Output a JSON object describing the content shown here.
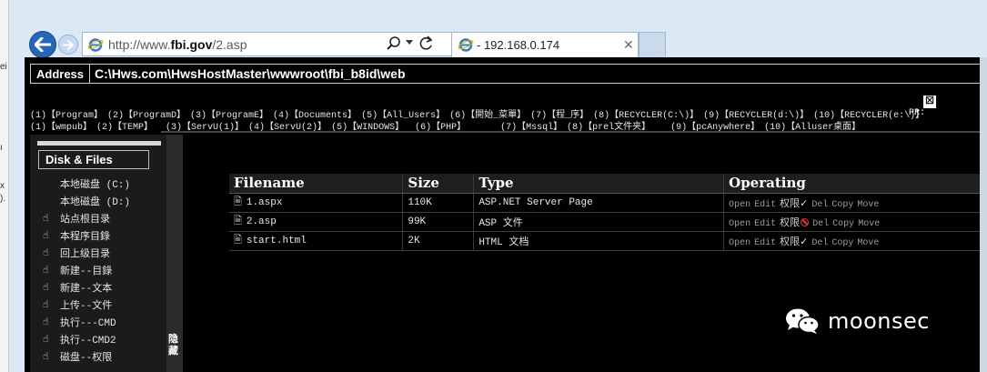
{
  "browser": {
    "url_prefix": "http://www.",
    "url_domain": "fbi.gov",
    "url_suffix": "/2.asp",
    "tab_title": "- 192.168.0.174"
  },
  "address": {
    "label": "Address",
    "path": "C:\\Hws.com\\HwsHostMaster\\wwwroot\\fbi_b8id\\web"
  },
  "dir_links_row1": [
    "(1)【Program】",
    "(2)【ProgramD】",
    "(3)【ProgramE】",
    "(4)【Documents】",
    "(5)【All_Users】",
    "(6)【開始_菜單】",
    "(7)【程_序】",
    "(8)【RECYCLER(C:\\)】",
    "(9)【RECYCLER(d:\\)】",
    "(10)【RECYCLER(e:\\)】"
  ],
  "dir_links_row2": [
    "(1)【wmpub】",
    "(2)【TEMP】",
    "(3)【ServU(1)】",
    "(4)【ServU(2)】",
    "(5)【WINDOWS】",
    "(6)【PHP】",
    "(7)【Mssql】",
    "(8)【prel文件夹】",
    "(9)【pcAnywhere】",
    "(10)【Alluser桌面】"
  ],
  "pr_label": "PR:",
  "close_glyph": "☒",
  "sidebar": {
    "title": "Disk & Files",
    "drives": [
      "本地磁盘 (C:)",
      "本地磁盘 (D:)"
    ],
    "actions": [
      "站点根目录",
      "本程序目錄",
      "回上级目录",
      "新建--目錄",
      "新建--文本",
      "上传--文件",
      "执行---CMD",
      "执行--CMD2",
      "磁盘--权限"
    ]
  },
  "splitter_label": "隐藏",
  "table": {
    "headers": [
      "Filename",
      "Size",
      "Type",
      "Operating"
    ],
    "rows": [
      {
        "name": "1.aspx",
        "size": "110K",
        "type": "ASP.NET Server Page",
        "perm_ok": true
      },
      {
        "name": "2.asp",
        "size": "99K",
        "type": "ASP 文件",
        "perm_ok": false
      },
      {
        "name": "start.html",
        "size": "2K",
        "type": "HTML 文档",
        "perm_ok": true
      }
    ],
    "ops": {
      "open": "Open",
      "edit": "Edit",
      "perm": "权限",
      "del": "Del",
      "copy": "Copy",
      "move": "Move"
    }
  },
  "watermark": "moonsec",
  "colors": {
    "chrome_bg": "#dce9f5",
    "back_button": "#2566b8",
    "page_bg": "#000000",
    "deny_icon": "#e33333"
  }
}
